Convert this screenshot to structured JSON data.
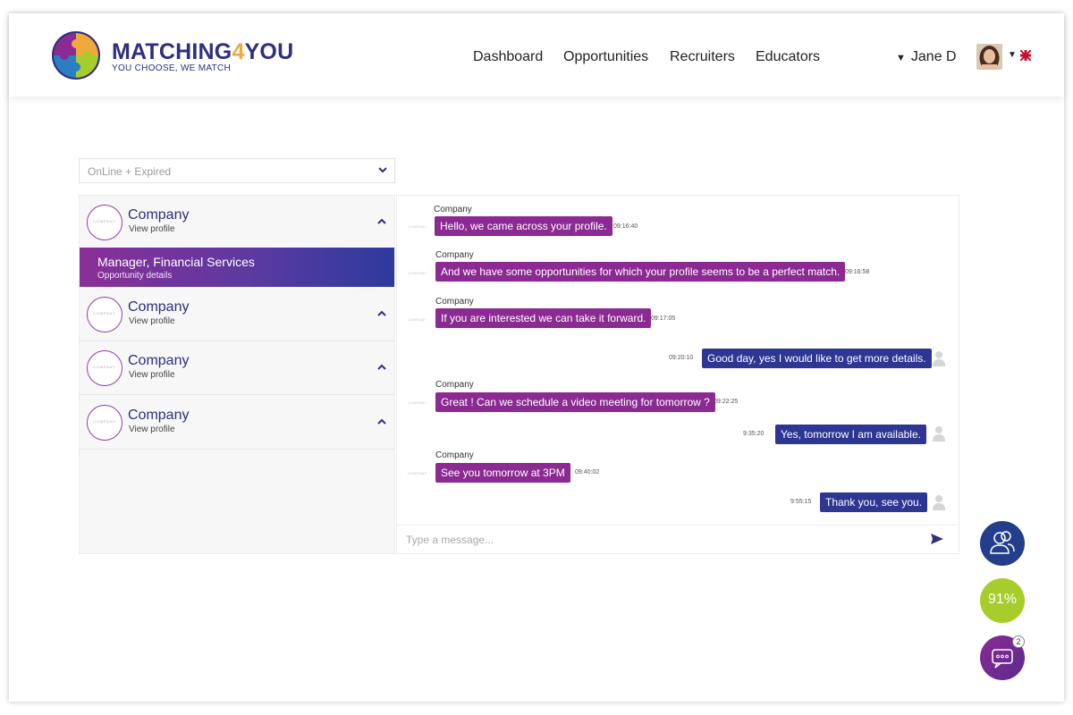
{
  "brand": {
    "name_part1": "MATCHING",
    "name_part2": "4",
    "name_part3": "YOU",
    "tagline": "YOU CHOOSE, WE MATCH"
  },
  "nav": {
    "items": [
      "Dashboard",
      "Opportunities",
      "Recruiters",
      "Educators"
    ]
  },
  "user": {
    "name": "Jane D"
  },
  "filter": {
    "selected": "OnLine + Expired"
  },
  "companies": [
    {
      "name": "Company",
      "link": "View profile",
      "logo_text": "COMPANY"
    },
    {
      "name": "Company",
      "link": "View profile",
      "logo_text": "COMPANY"
    },
    {
      "name": "Company",
      "link": "View profile",
      "logo_text": "COMPANY"
    },
    {
      "name": "Company",
      "link": "View profile",
      "logo_text": "COMPANY"
    }
  ],
  "opportunity": {
    "title": "Manager, Financial Services",
    "link": "Opportunity details"
  },
  "chat": {
    "messages": [
      {
        "author": "Company",
        "text": "Hello, we came across your profile.",
        "time": "09:16:40",
        "direction": "in"
      },
      {
        "author": "Company",
        "text": "And we have some opportunities for which your profile seems to be a perfect match.",
        "time": "09:16:58",
        "direction": "in"
      },
      {
        "author": "Company",
        "text": "If you are interested we can take it forward.",
        "time": "09:17:05",
        "direction": "in"
      },
      {
        "author": "",
        "text": "Good day, yes I would like to get more details.",
        "time": "09:20:10",
        "direction": "out"
      },
      {
        "author": "Company",
        "text": "Great ! Can we schedule a video meeting for tomorrow ?",
        "time": "09:22:25",
        "direction": "in"
      },
      {
        "author": "",
        "text": "Yes, tomorrow I am available.",
        "time": "9:35:20",
        "direction": "out"
      },
      {
        "author": "Company",
        "text": "See you tomorrow at 3PM",
        "time": "09:40:02",
        "direction": "in"
      },
      {
        "author": "",
        "text": "Thank you, see you.",
        "time": "9:55:15",
        "direction": "out"
      }
    ],
    "input_placeholder": "Type a message..."
  },
  "fabs": {
    "match_score": "91%",
    "notification_count": "2"
  },
  "colors": {
    "brand_navy": "#2e2f7f",
    "brand_orange": "#f2a93b",
    "incoming": "#8b2a92",
    "outgoing": "#2e3693",
    "match_green": "#a6cd2b"
  }
}
